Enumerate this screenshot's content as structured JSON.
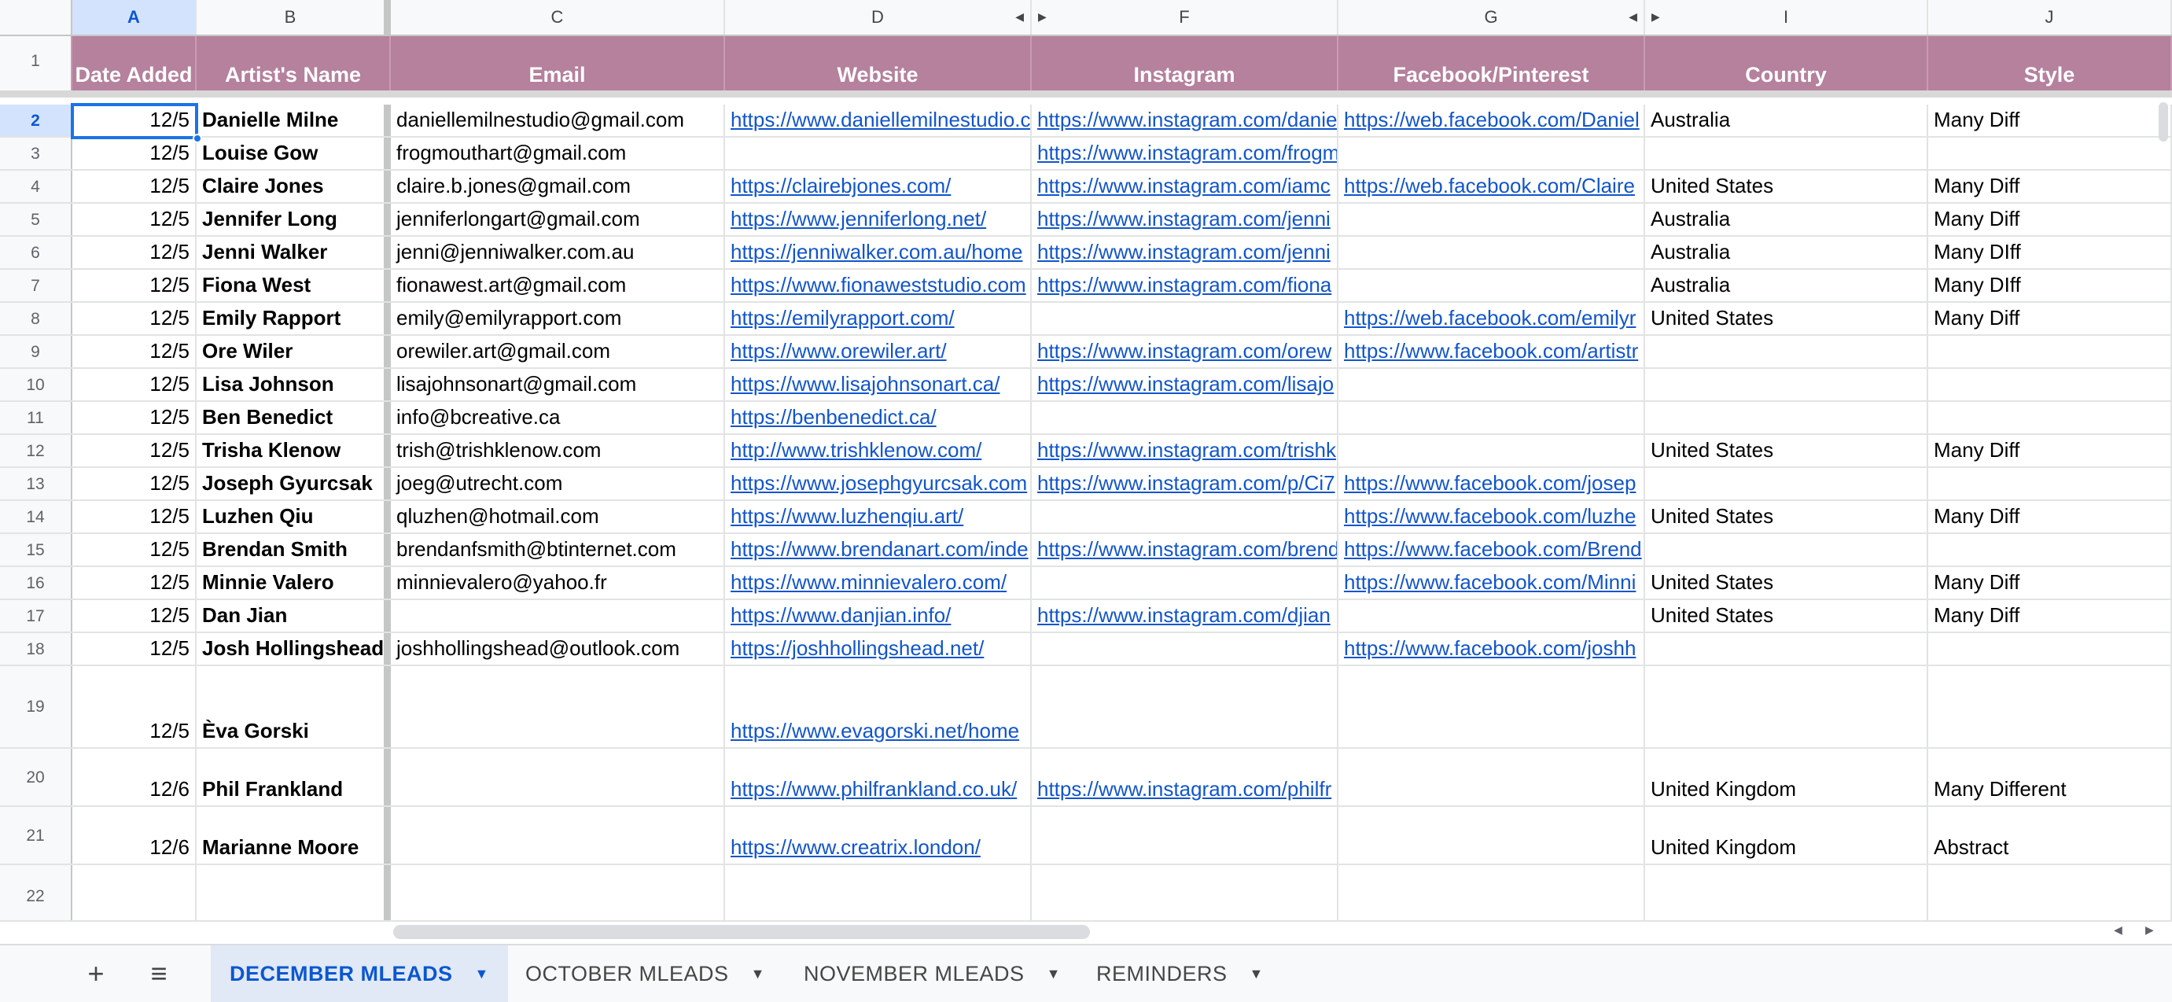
{
  "columns": [
    "A",
    "B",
    "C",
    "D",
    "F",
    "G",
    "I",
    "J"
  ],
  "headers": {
    "date_added": "Date Added",
    "artist_name": "Artist's Name",
    "email": "Email",
    "website": "Website",
    "instagram": "Instagram",
    "facebook": "Facebook/Pinterest",
    "country": "Country",
    "style": "Style"
  },
  "rows": [
    {
      "n": "2",
      "date": "12/5",
      "name": "Danielle Milne",
      "email": "daniellemilnestudio@gmail.com",
      "website": "https://www.daniellemilnestudio.c",
      "instagram": "https://www.instagram.com/danie",
      "facebook": "https://web.facebook.com/Daniel",
      "country": "Australia",
      "style": "Many Diff"
    },
    {
      "n": "3",
      "date": "12/5",
      "name": "Louise Gow",
      "email": "frogmouthart@gmail.com",
      "website": "",
      "instagram": "https://www.instagram.com/frogm",
      "facebook": "",
      "country": "",
      "style": ""
    },
    {
      "n": "4",
      "date": "12/5",
      "name": "Claire Jones",
      "email": "claire.b.jones@gmail.com",
      "website": "https://clairebjones.com/",
      "instagram": "https://www.instagram.com/iamc",
      "facebook": "https://web.facebook.com/Claire",
      "country": "United States",
      "style": "Many Diff"
    },
    {
      "n": "5",
      "date": "12/5",
      "name": "Jennifer Long",
      "email": "jenniferlongart@gmail.com",
      "website": "https://www.jenniferlong.net/",
      "instagram": "https://www.instagram.com/jenni",
      "facebook": "",
      "country": "Australia",
      "style": "Many Diff"
    },
    {
      "n": "6",
      "date": "12/5",
      "name": "Jenni Walker",
      "email": "jenni@jenniwalker.com.au",
      "website": "https://jenniwalker.com.au/home",
      "instagram": "https://www.instagram.com/jenni",
      "facebook": "",
      "country": "Australia",
      "style": "Many DIff"
    },
    {
      "n": "7",
      "date": "12/5",
      "name": "Fiona West",
      "email": "fionawest.art@gmail.com",
      "website": "https://www.fionaweststudio.com",
      "instagram": "https://www.instagram.com/fiona",
      "facebook": "",
      "country": "Australia",
      "style": "Many DIff"
    },
    {
      "n": "8",
      "date": "12/5",
      "name": "Emily Rapport",
      "email": "emily@emilyrapport.com",
      "website": "https://emilyrapport.com/",
      "instagram": "",
      "facebook": "https://web.facebook.com/emilyr",
      "country": "United States",
      "style": "Many Diff"
    },
    {
      "n": "9",
      "date": "12/5",
      "name": "Ore Wiler",
      "email": "orewiler.art@gmail.com",
      "website": "https://www.orewiler.art/",
      "instagram": "https://www.instagram.com/orew",
      "facebook": "https://www.facebook.com/artistr",
      "country": "",
      "style": ""
    },
    {
      "n": "10",
      "date": "12/5",
      "name": "Lisa Johnson",
      "email": "lisajohnsonart@gmail.com",
      "website": "https://www.lisajohnsonart.ca/",
      "instagram": "https://www.instagram.com/lisajo",
      "facebook": "",
      "country": "",
      "style": ""
    },
    {
      "n": "11",
      "date": "12/5",
      "name": "Ben Benedict",
      "email": "info@bcreative.ca",
      "website": "https://benbenedict.ca/",
      "instagram": "",
      "facebook": "",
      "country": "",
      "style": ""
    },
    {
      "n": "12",
      "date": "12/5",
      "name": "Trisha Klenow",
      "email": "trish@trishklenow.com",
      "website": "http://www.trishklenow.com/",
      "instagram": "https://www.instagram.com/trishk",
      "facebook": "",
      "country": "United States",
      "style": "Many Diff"
    },
    {
      "n": "13",
      "date": "12/5",
      "name": "Joseph Gyurcsak",
      "email": "joeg@utrecht.com",
      "website": "https://www.josephgyurcsak.com",
      "instagram": "https://www.instagram.com/p/Ci7",
      "facebook": "https://www.facebook.com/josep",
      "country": "",
      "style": ""
    },
    {
      "n": "14",
      "date": "12/5",
      "name": "Luzhen Qiu",
      "email": "qluzhen@hotmail.com",
      "website": "https://www.luzhenqiu.art/",
      "instagram": "",
      "facebook": "https://www.facebook.com/luzhe",
      "country": "United States",
      "style": "Many Diff"
    },
    {
      "n": "15",
      "date": "12/5",
      "name": "Brendan Smith",
      "email": "brendanfsmith@btinternet.com",
      "website": "https://www.brendanart.com/inde",
      "instagram": "https://www.instagram.com/brend",
      "facebook": "https://www.facebook.com/Brend",
      "country": "",
      "style": ""
    },
    {
      "n": "16",
      "date": "12/5",
      "name": "Minnie Valero",
      "email": "minnievalero@yahoo.fr",
      "website": "https://www.minnievalero.com/",
      "instagram": "",
      "facebook": "https://www.facebook.com/Minni",
      "country": "United States",
      "style": "Many Diff"
    },
    {
      "n": "17",
      "date": "12/5",
      "name": "Dan Jian",
      "email": "",
      "website": "https://www.danjian.info/",
      "instagram": "https://www.instagram.com/djian",
      "facebook": "",
      "country": "United States",
      "style": "Many Diff"
    },
    {
      "n": "18",
      "date": "12/5",
      "name": "Josh Hollingshead",
      "email": "joshhollingshead@outlook.com",
      "website": "https://joshhollingshead.net/",
      "instagram": "",
      "facebook": "https://www.facebook.com/joshh",
      "country": "",
      "style": ""
    },
    {
      "n": "19",
      "date": "12/5",
      "name": "Èva Gorski",
      "email": "",
      "website": "https://www.evagorski.net/home",
      "instagram": "",
      "facebook": "",
      "country": "",
      "style": ""
    },
    {
      "n": "20",
      "date": "12/6",
      "name": "Phil Frankland",
      "email": "",
      "website": "https://www.philfrankland.co.uk/",
      "instagram": "https://www.instagram.com/philfr",
      "facebook": "",
      "country": "United Kingdom",
      "style": "Many Different"
    },
    {
      "n": "21",
      "date": "12/6",
      "name": "Marianne Moore",
      "email": "",
      "website": "https://www.creatrix.london/",
      "instagram": "",
      "facebook": "",
      "country": "United Kingdom",
      "style": "Abstract"
    },
    {
      "n": "22",
      "date": "",
      "name": "",
      "email": "",
      "website": "",
      "instagram": "",
      "facebook": "",
      "country": "",
      "style": ""
    }
  ],
  "row1_label": "1",
  "tabs": [
    {
      "label": "DECEMBER MLEADS",
      "active": true
    },
    {
      "label": "OCTOBER MLEADS",
      "active": false
    },
    {
      "label": "NOVEMBER MLEADS",
      "active": false
    },
    {
      "label": "REMINDERS",
      "active": false
    }
  ],
  "icons": {
    "add_sheet": "plus-icon",
    "all_sheets": "menu-icon",
    "tab_caret": "caret-down-icon"
  },
  "colors": {
    "header_bg": "#b5819d",
    "link": "#1155cc",
    "selection": "#1a73e8",
    "active_tab": "#0b57d0"
  }
}
